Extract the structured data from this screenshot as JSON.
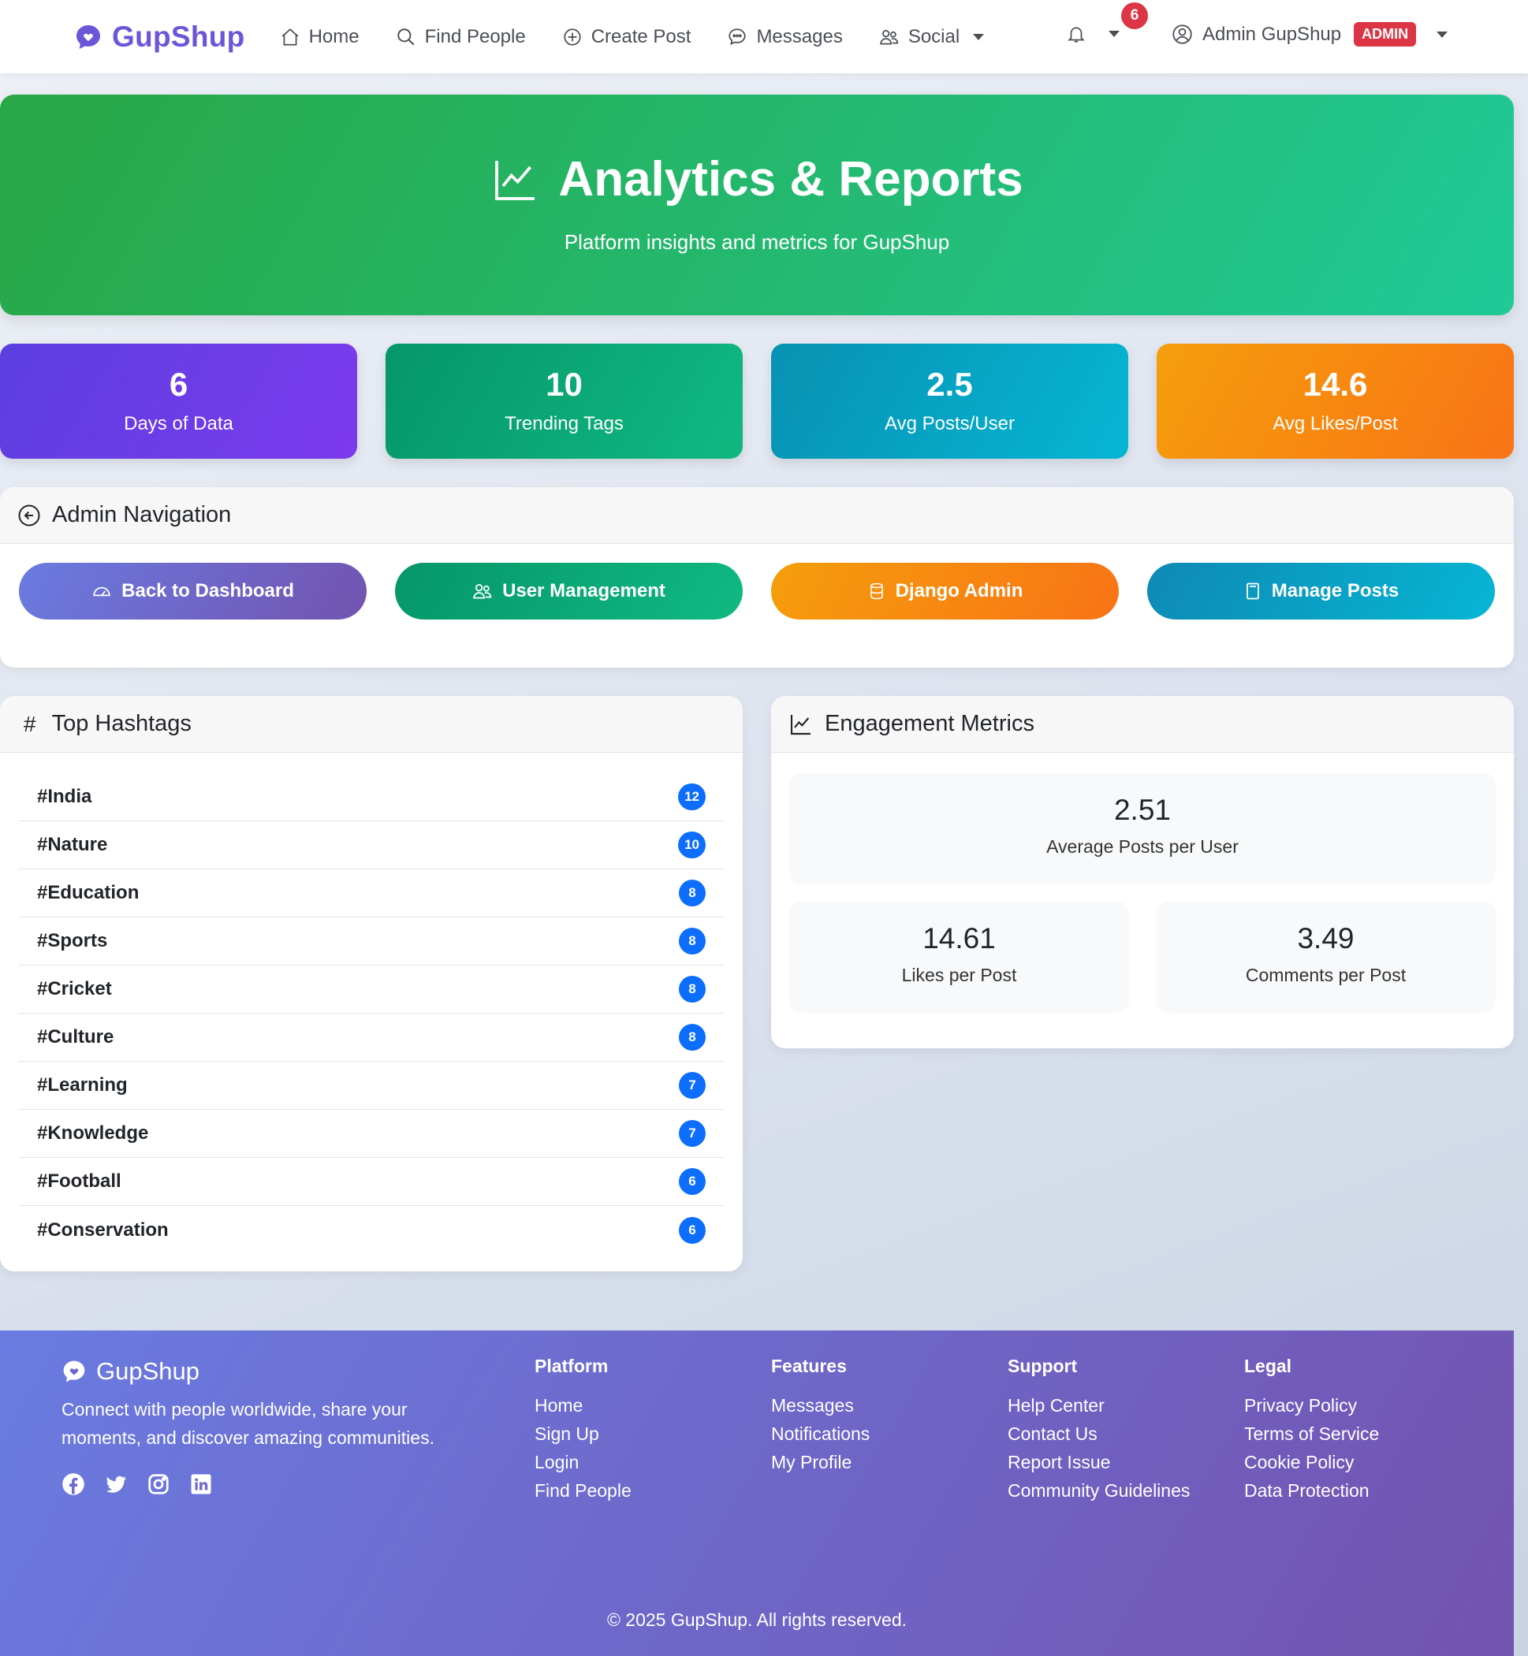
{
  "navbar": {
    "brand": "GupShup",
    "links": [
      {
        "label": "Home",
        "icon": "home-icon"
      },
      {
        "label": "Find People",
        "icon": "search-icon"
      },
      {
        "label": "Create Post",
        "icon": "plus-circle-icon"
      },
      {
        "label": "Messages",
        "icon": "chat-icon"
      },
      {
        "label": "Social",
        "icon": "people-icon"
      }
    ],
    "notification_count": "6",
    "user_name": "Admin GupShup",
    "user_badge": "ADMIN"
  },
  "hero": {
    "title": "Analytics & Reports",
    "subtitle": "Platform insights and metrics for GupShup"
  },
  "stats": [
    {
      "value": "6",
      "label": "Days of Data",
      "color_from": "#5b3fe0",
      "color_to": "#7c3aed"
    },
    {
      "value": "10",
      "label": "Trending Tags",
      "color_from": "#059669",
      "color_to": "#10b981"
    },
    {
      "value": "2.5",
      "label": "Avg Posts/User",
      "color_from": "#0891b2",
      "color_to": "#06b6d4"
    },
    {
      "value": "14.6",
      "label": "Avg Likes/Post",
      "color_from": "#f59e0b",
      "color_to": "#f97316"
    }
  ],
  "admin_nav": {
    "title": "Admin Navigation",
    "buttons": [
      {
        "label": "Back to Dashboard",
        "icon": "speedometer-icon"
      },
      {
        "label": "User Management",
        "icon": "people-icon"
      },
      {
        "label": "Django Admin",
        "icon": "database-icon"
      },
      {
        "label": "Manage Posts",
        "icon": "file-icon"
      }
    ]
  },
  "hashtags": {
    "title": "Top Hashtags",
    "items": [
      {
        "tag": "#India",
        "count": "12"
      },
      {
        "tag": "#Nature",
        "count": "10"
      },
      {
        "tag": "#Education",
        "count": "8"
      },
      {
        "tag": "#Sports",
        "count": "8"
      },
      {
        "tag": "#Cricket",
        "count": "8"
      },
      {
        "tag": "#Culture",
        "count": "8"
      },
      {
        "tag": "#Learning",
        "count": "7"
      },
      {
        "tag": "#Knowledge",
        "count": "7"
      },
      {
        "tag": "#Football",
        "count": "6"
      },
      {
        "tag": "#Conservation",
        "count": "6"
      }
    ]
  },
  "engagement": {
    "title": "Engagement Metrics",
    "avg_posts": {
      "value": "2.51",
      "label": "Average Posts per User"
    },
    "likes": {
      "value": "14.61",
      "label": "Likes per Post"
    },
    "comments": {
      "value": "3.49",
      "label": "Comments per Post"
    }
  },
  "footer": {
    "brand": "GupShup",
    "description": "Connect with people worldwide, share your moments, and discover amazing communities.",
    "columns": [
      {
        "title": "Platform",
        "links": [
          "Home",
          "Sign Up",
          "Login",
          "Find People"
        ]
      },
      {
        "title": "Features",
        "links": [
          "Messages",
          "Notifications",
          "My Profile"
        ]
      },
      {
        "title": "Support",
        "links": [
          "Help Center",
          "Contact Us",
          "Report Issue",
          "Community Guidelines"
        ]
      },
      {
        "title": "Legal",
        "links": [
          "Privacy Policy",
          "Terms of Service",
          "Cookie Policy",
          "Data Protection"
        ]
      }
    ],
    "copyright": "© 2025 GupShup. All rights reserved."
  }
}
